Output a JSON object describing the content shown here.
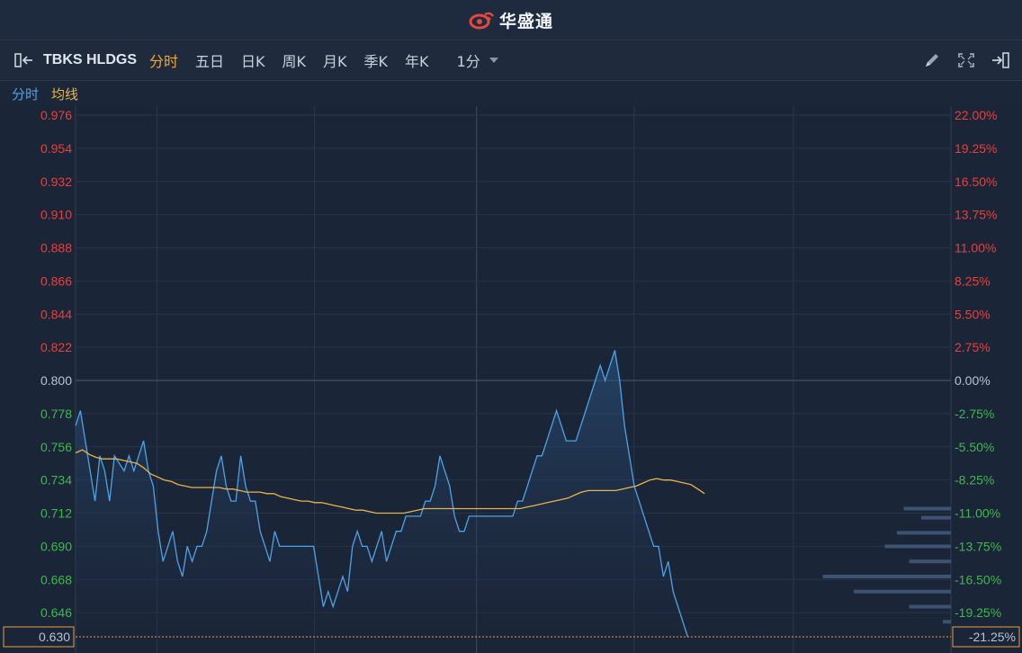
{
  "app": {
    "brand": "华盛通",
    "brand_color": "#e8473c"
  },
  "toolbar": {
    "symbol": "TBKS HLDGS",
    "tabs": [
      {
        "label": "分时",
        "active": true
      },
      {
        "label": "五日",
        "active": false
      },
      {
        "label": "日K",
        "active": false
      },
      {
        "label": "周K",
        "active": false
      },
      {
        "label": "月K",
        "active": false
      },
      {
        "label": "季K",
        "active": false
      },
      {
        "label": "年K",
        "active": false
      }
    ],
    "interval": "1分",
    "icons": [
      "draw-pencil-icon",
      "fullscreen-icon",
      "exit-icon"
    ]
  },
  "legend": {
    "price_label": "分时",
    "avg_label": "均线",
    "price_color": "#4ea3e8",
    "avg_color": "#e8b44a"
  },
  "chart_data": {
    "type": "line",
    "prev_close": 0.8,
    "ylim": [
      0.63,
      0.976
    ],
    "y_ticks": [
      "0.976",
      "0.954",
      "0.932",
      "0.910",
      "0.888",
      "0.866",
      "0.844",
      "0.822",
      "0.800",
      "0.778",
      "0.756",
      "0.734",
      "0.712",
      "0.690",
      "0.668",
      "0.646"
    ],
    "pct_ticks": [
      "22.00%",
      "19.25%",
      "16.50%",
      "13.75%",
      "11.00%",
      "8.25%",
      "5.50%",
      "2.75%",
      "0.00%",
      "-2.75%",
      "-5.50%",
      "-8.25%",
      "-11.00%",
      "-13.75%",
      "-16.50%",
      "-19.25%"
    ],
    "current_price": "0.630",
    "current_pct": "-21.25%",
    "up_color": "#e8403a",
    "down_color": "#3fb84c",
    "neutral_color": "#b8c2d0",
    "series": [
      {
        "name": "分时",
        "values": [
          0.77,
          0.78,
          0.76,
          0.74,
          0.72,
          0.75,
          0.74,
          0.72,
          0.75,
          0.745,
          0.74,
          0.75,
          0.74,
          0.75,
          0.76,
          0.74,
          0.73,
          0.7,
          0.68,
          0.69,
          0.7,
          0.68,
          0.67,
          0.69,
          0.68,
          0.69,
          0.69,
          0.7,
          0.72,
          0.74,
          0.75,
          0.73,
          0.72,
          0.72,
          0.75,
          0.73,
          0.72,
          0.72,
          0.7,
          0.69,
          0.68,
          0.7,
          0.69,
          0.69,
          0.69,
          0.69,
          0.69,
          0.69,
          0.69,
          0.69,
          0.67,
          0.65,
          0.66,
          0.65,
          0.66,
          0.67,
          0.66,
          0.69,
          0.7,
          0.69,
          0.69,
          0.68,
          0.69,
          0.7,
          0.68,
          0.69,
          0.7,
          0.7,
          0.71,
          0.71,
          0.71,
          0.71,
          0.72,
          0.72,
          0.73,
          0.75,
          0.74,
          0.73,
          0.71,
          0.7,
          0.7,
          0.71,
          0.71,
          0.71,
          0.71,
          0.71,
          0.71,
          0.71,
          0.71,
          0.71,
          0.71,
          0.72,
          0.72,
          0.73,
          0.74,
          0.75,
          0.75,
          0.76,
          0.77,
          0.78,
          0.77,
          0.76,
          0.76,
          0.76,
          0.77,
          0.78,
          0.79,
          0.8,
          0.81,
          0.8,
          0.81,
          0.82,
          0.8,
          0.77,
          0.75,
          0.73,
          0.72,
          0.71,
          0.7,
          0.69,
          0.69,
          0.67,
          0.68,
          0.66,
          0.65,
          0.64,
          0.63
        ]
      },
      {
        "name": "均线",
        "values": [
          0.752,
          0.754,
          0.751,
          0.749,
          0.748,
          0.748,
          0.748,
          0.747,
          0.746,
          0.745,
          0.742,
          0.738,
          0.736,
          0.734,
          0.733,
          0.731,
          0.73,
          0.729,
          0.729,
          0.729,
          0.729,
          0.729,
          0.728,
          0.728,
          0.727,
          0.726,
          0.726,
          0.726,
          0.725,
          0.725,
          0.723,
          0.722,
          0.721,
          0.72,
          0.72,
          0.719,
          0.719,
          0.718,
          0.717,
          0.716,
          0.715,
          0.714,
          0.714,
          0.713,
          0.712,
          0.712,
          0.712,
          0.712,
          0.712,
          0.713,
          0.714,
          0.715,
          0.715,
          0.715,
          0.715,
          0.715,
          0.715,
          0.715,
          0.715,
          0.715,
          0.715,
          0.715,
          0.715,
          0.715,
          0.715,
          0.715,
          0.716,
          0.717,
          0.718,
          0.719,
          0.72,
          0.721,
          0.722,
          0.724,
          0.726,
          0.727,
          0.727,
          0.727,
          0.727,
          0.727,
          0.728,
          0.729,
          0.73,
          0.732,
          0.734,
          0.735,
          0.734,
          0.734,
          0.733,
          0.732,
          0.731,
          0.728,
          0.725
        ]
      }
    ],
    "depth_bars": [
      {
        "price": 0.715,
        "weight": 0.35
      },
      {
        "price": 0.709,
        "weight": 0.22
      },
      {
        "price": 0.699,
        "weight": 0.4
      },
      {
        "price": 0.69,
        "weight": 0.49
      },
      {
        "price": 0.68,
        "weight": 0.31
      },
      {
        "price": 0.67,
        "weight": 0.95
      },
      {
        "price": 0.66,
        "weight": 0.72
      },
      {
        "price": 0.65,
        "weight": 0.31
      },
      {
        "price": 0.64,
        "weight": 0.06
      }
    ]
  }
}
